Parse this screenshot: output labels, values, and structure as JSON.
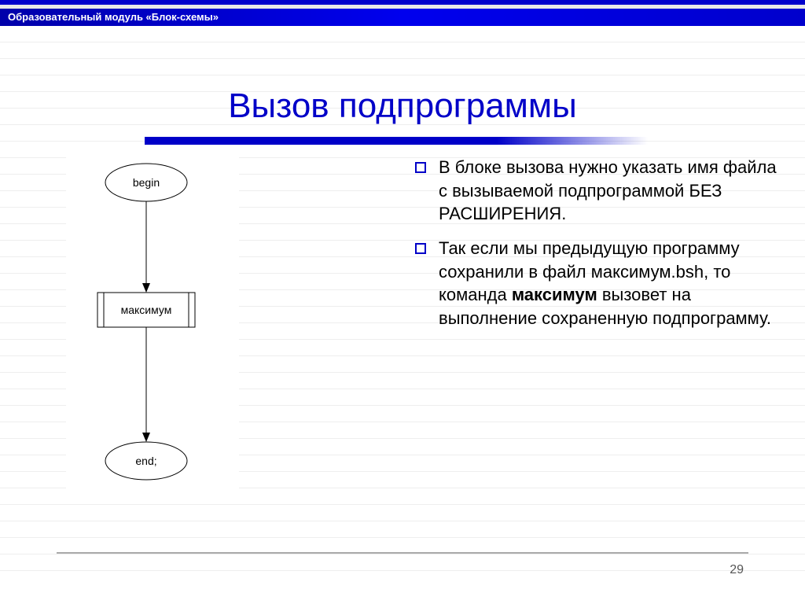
{
  "header": {
    "title": "Образовательный модуль «Блок-схемы»"
  },
  "slide": {
    "title": "Вызов подпрограммы",
    "page_number": "29"
  },
  "flowchart": {
    "begin": "begin",
    "process": "максимум",
    "end": "end;"
  },
  "bullets": [
    "В блоке вызова нужно указать имя файла с вызываемой подпрограммой БЕЗ РАСШИРЕНИЯ.",
    "Так если мы предыдущую программу сохранили в файл максимум.bsh, то команда <b>максимум</b> вызовет на выполнение сохраненную подпрограмму."
  ]
}
